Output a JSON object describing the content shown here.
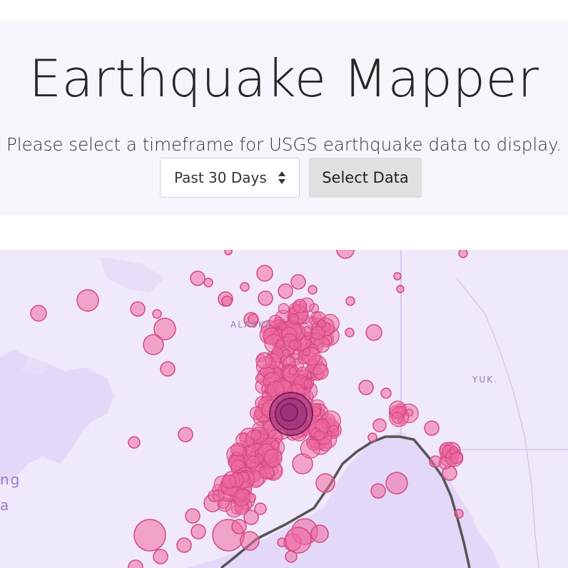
{
  "header": {
    "title": "Earthquake Mapper",
    "subtitle": "Please select a timeframe for USGS earthquake data to display."
  },
  "controls": {
    "timeframe_selected": "Past 30 Days",
    "timeframe_caret_icon": "up-down-caret-icon",
    "select_button_label": "Select Data"
  },
  "map": {
    "labels": {
      "alaska": "ALASKA",
      "yukon": "YUK.",
      "left_partial_1": "ng",
      "left_partial_2": "a"
    },
    "colors": {
      "land": "#efe7fb",
      "water": "#e5d9f8",
      "border": "#c9b6e6",
      "plate_line": "#4d4d4d",
      "quake_fill": "#f0679e",
      "quake_stroke": "#d24a83",
      "quake_dark": "#9a2f78"
    }
  }
}
